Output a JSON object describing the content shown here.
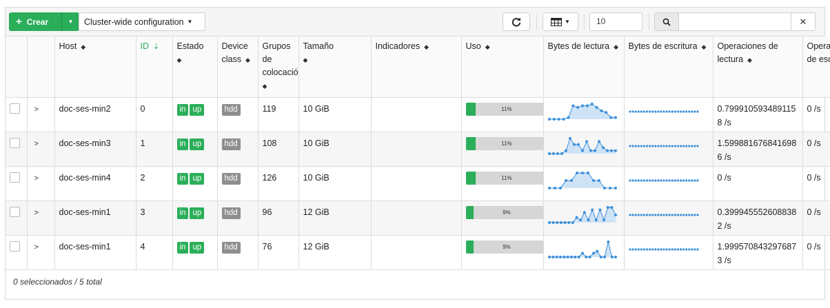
{
  "toolbar": {
    "create_label": "Crear",
    "config_dropdown": "Cluster-wide configuration",
    "page_size": "10",
    "search_value": ""
  },
  "columns": {
    "host": "Host",
    "id": "ID",
    "estado": "Estado",
    "device_class": "Device class",
    "grupos": "Grupos de colocación",
    "tamano": "Tamaño",
    "indicadores": "Indicadores",
    "uso": "Uso",
    "bytes_lectura": "Bytes de lectura",
    "bytes_escritura": "Bytes de escritura",
    "ops_lectura": "Operaciones de lectura",
    "ops_escritura": "Operaciones de escritura"
  },
  "rows": [
    {
      "host": "doc-ses-min2",
      "id": "0",
      "status_in": "in",
      "status_up": "up",
      "device_class": "hdd",
      "pgs": "119",
      "size": "10 GiB",
      "flags": "",
      "usage_pct": 11,
      "usage_label": "11%",
      "read_ops": "0.7999105934891158 /s",
      "write_ops": "0 /s",
      "read_bytes": [
        0,
        0,
        0,
        0,
        1,
        8,
        7,
        8,
        8,
        9,
        7,
        5,
        4,
        1,
        1
      ],
      "write_bytes": [
        0,
        0,
        0,
        0,
        0,
        0,
        0,
        0,
        0,
        0,
        0,
        0,
        0,
        0,
        0,
        0,
        0,
        0,
        0,
        0,
        0,
        0,
        0,
        0,
        0
      ]
    },
    {
      "host": "doc-ses-min3",
      "id": "1",
      "status_in": "in",
      "status_up": "up",
      "device_class": "hdd",
      "pgs": "108",
      "size": "10 GiB",
      "flags": "",
      "usage_pct": 11,
      "usage_label": "11%",
      "read_ops": "1.5998816768416986 /s",
      "write_ops": "0 /s",
      "read_bytes": [
        0,
        0,
        0,
        0,
        1,
        5,
        3,
        3,
        1,
        4,
        1,
        1,
        4,
        2,
        1,
        1,
        1
      ],
      "write_bytes": [
        0,
        0,
        0,
        0,
        0,
        0,
        0,
        0,
        0,
        0,
        0,
        0,
        0,
        0,
        0,
        0,
        0,
        0,
        0,
        0,
        0,
        0,
        0,
        0,
        0
      ]
    },
    {
      "host": "doc-ses-min4",
      "id": "2",
      "status_in": "in",
      "status_up": "up",
      "device_class": "hdd",
      "pgs": "126",
      "size": "10 GiB",
      "flags": "",
      "usage_pct": 11,
      "usage_label": "11%",
      "read_ops": "0 /s",
      "write_ops": "0 /s",
      "read_bytes": [
        0,
        0,
        0,
        1,
        1,
        2,
        2,
        2,
        1,
        1,
        0,
        0,
        0
      ],
      "write_bytes": [
        0,
        0,
        0,
        0,
        0,
        0,
        0,
        0,
        0,
        0,
        0,
        0,
        0,
        0,
        0,
        0,
        0,
        0,
        0,
        0,
        0,
        0,
        0,
        0,
        0
      ]
    },
    {
      "host": "doc-ses-min1",
      "id": "3",
      "status_in": "in",
      "status_up": "up",
      "device_class": "hdd",
      "pgs": "96",
      "size": "12 GiB",
      "flags": "",
      "usage_pct": 9,
      "usage_label": "9%",
      "read_ops": "0.3999455526088382 /s",
      "write_ops": "0 /s",
      "read_bytes": [
        0,
        0,
        0,
        0,
        0,
        0,
        0,
        2,
        1,
        4,
        1,
        5,
        1,
        5,
        1,
        6,
        6,
        3
      ],
      "write_bytes": [
        0,
        0,
        0,
        0,
        0,
        0,
        0,
        0,
        0,
        0,
        0,
        0,
        0,
        0,
        0,
        0,
        0,
        0,
        0,
        0,
        0,
        0,
        0,
        0,
        0
      ]
    },
    {
      "host": "doc-ses-min1",
      "id": "4",
      "status_in": "in",
      "status_up": "up",
      "device_class": "hdd",
      "pgs": "76",
      "size": "12 GiB",
      "flags": "",
      "usage_pct": 9,
      "usage_label": "9%",
      "read_ops": "1.9995708432976873 /s",
      "write_ops": "0 /s",
      "read_bytes": [
        0,
        0,
        0,
        0,
        0,
        0,
        0,
        0,
        0,
        2,
        0,
        0,
        2,
        3,
        0,
        0,
        8,
        0,
        0
      ],
      "write_bytes": [
        0,
        0,
        0,
        0,
        0,
        0,
        0,
        0,
        0,
        0,
        0,
        0,
        0,
        0,
        0,
        0,
        0,
        0,
        0,
        0,
        0,
        0,
        0,
        0,
        0
      ]
    }
  ],
  "footer": {
    "summary": "0 seleccionados / 5 total"
  },
  "colors": {
    "accent": "#2bae5a",
    "spark_line": "#3a8fd9",
    "spark_fill": "#cfe3f6"
  }
}
